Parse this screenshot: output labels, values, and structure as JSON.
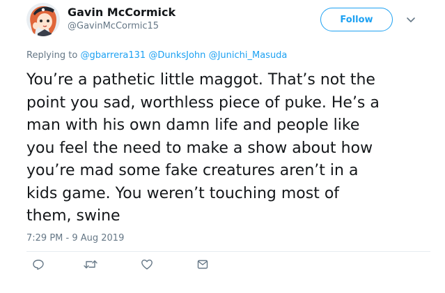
{
  "tweet": {
    "author": {
      "name": "Gavin McCormick",
      "handle": "@GavinMcCormic15"
    },
    "follow_label": "Follow",
    "replying_prefix": "Replying to",
    "replying_to": [
      "@gbarrera131",
      "@DunksJohn",
      "@Junichi_Masuda"
    ],
    "text_lines": [
      "You’re a pathetic little maggot. That’s not the",
      "point you sad, worthless piece of puke. He’s a",
      "man with his own damn life and people like",
      "you feel the need to make a show about how",
      "you’re mad some fake creatures aren’t in a",
      "kids game. You weren’t touching most of",
      "them, swine"
    ],
    "timestamp": "7:29 PM - 9 Aug 2019",
    "actions": [
      "reply-icon",
      "retweet-icon",
      "like-icon",
      "direct-message-icon"
    ]
  },
  "colors": {
    "link": "#1da1f2",
    "secondary_text": "#657786",
    "primary_text": "#14171a"
  }
}
